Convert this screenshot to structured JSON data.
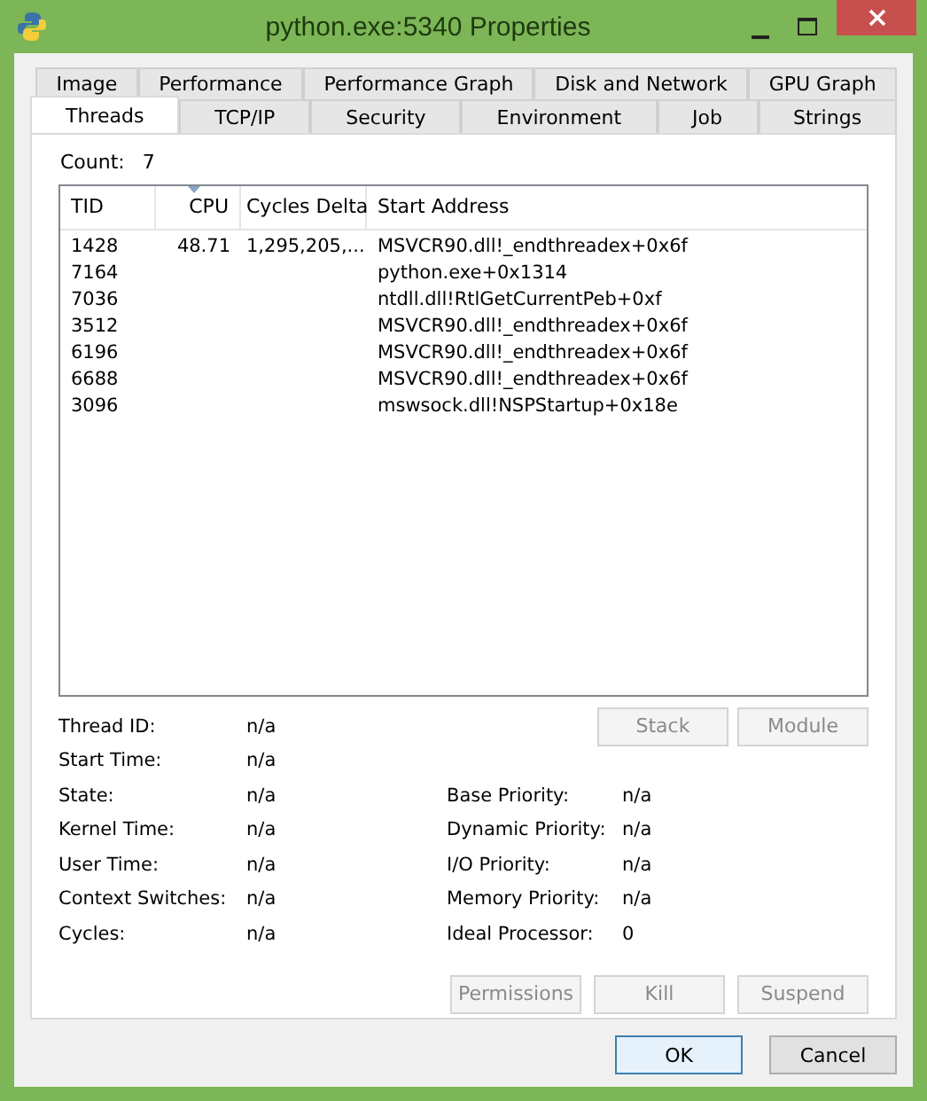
{
  "window": {
    "title": "python.exe:5340 Properties"
  },
  "tab_rows": [
    [
      {
        "label": "Image",
        "selected": false
      },
      {
        "label": "Performance",
        "selected": false
      },
      {
        "label": "Performance Graph",
        "selected": false
      },
      {
        "label": "Disk and Network",
        "selected": false
      },
      {
        "label": "GPU Graph",
        "selected": false
      }
    ],
    [
      {
        "label": "Threads",
        "selected": true
      },
      {
        "label": "TCP/IP",
        "selected": false
      },
      {
        "label": "Security",
        "selected": false
      },
      {
        "label": "Environment",
        "selected": false
      },
      {
        "label": "Job",
        "selected": false
      },
      {
        "label": "Strings",
        "selected": false
      }
    ]
  ],
  "count": {
    "label": "Count:",
    "value": "7"
  },
  "table": {
    "columns": [
      "TID",
      "CPU",
      "Cycles Delta",
      "Start Address"
    ],
    "rows": [
      [
        "1428",
        "48.71",
        "1,295,205,...",
        "MSVCR90.dll!_endthreadex+0x6f"
      ],
      [
        "7164",
        "",
        "",
        "python.exe+0x1314"
      ],
      [
        "7036",
        "",
        "",
        "ntdll.dll!RtlGetCurrentPeb+0xf"
      ],
      [
        "3512",
        "",
        "",
        "MSVCR90.dll!_endthreadex+0x6f"
      ],
      [
        "6196",
        "",
        "",
        "MSVCR90.dll!_endthreadex+0x6f"
      ],
      [
        "6688",
        "",
        "",
        "MSVCR90.dll!_endthreadex+0x6f"
      ],
      [
        "3096",
        "",
        "",
        "mswsock.dll!NSPStartup+0x18e"
      ]
    ]
  },
  "details": {
    "left": [
      {
        "label": "Thread ID:",
        "value": "n/a"
      },
      {
        "label": "Start Time:",
        "value": "n/a"
      },
      {
        "label": "State:",
        "value": "n/a"
      },
      {
        "label": "Kernel Time:",
        "value": "n/a"
      },
      {
        "label": "User Time:",
        "value": "n/a"
      },
      {
        "label": "Context Switches:",
        "value": "n/a"
      },
      {
        "label": "Cycles:",
        "value": "n/a"
      }
    ],
    "right": [
      {
        "label": "Base Priority:",
        "value": "n/a"
      },
      {
        "label": "Dynamic Priority:",
        "value": "n/a"
      },
      {
        "label": "I/O Priority:",
        "value": "n/a"
      },
      {
        "label": "Memory Priority:",
        "value": "n/a"
      },
      {
        "label": "Ideal Processor:",
        "value": "0"
      }
    ]
  },
  "thread_buttons": [
    {
      "label": "Stack",
      "disabled": true
    },
    {
      "label": "Module",
      "disabled": true
    }
  ],
  "action_buttons": [
    {
      "label": "Permissions",
      "disabled": true
    },
    {
      "label": "Kill",
      "disabled": true
    },
    {
      "label": "Suspend",
      "disabled": true
    }
  ],
  "dialog_buttons": [
    {
      "label": "OK",
      "default": true
    },
    {
      "label": "Cancel",
      "default": false
    }
  ]
}
